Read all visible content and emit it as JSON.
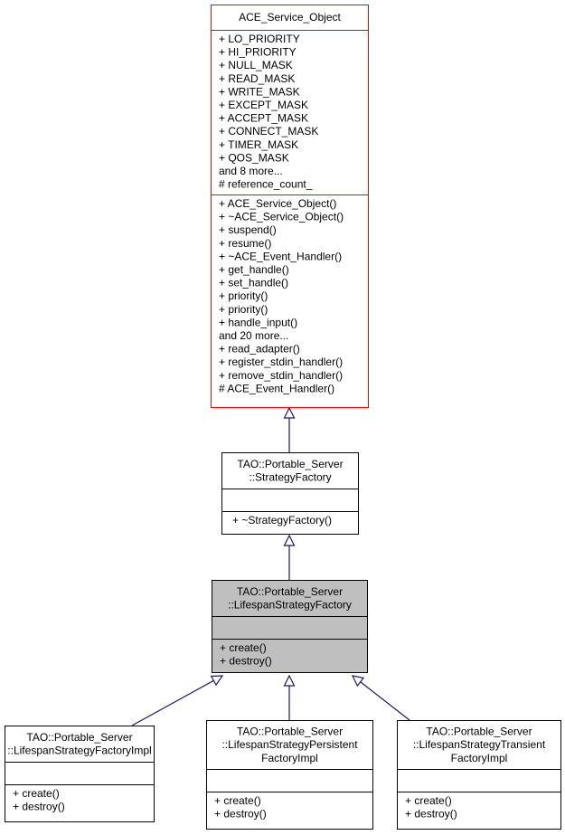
{
  "diagram": {
    "type": "uml-class-inheritance",
    "colors": {
      "highlight_border": "#ff0000",
      "border": "#000000",
      "focus_fill": "#bfbfbf",
      "fill": "#ffffff",
      "edge": "#191970"
    },
    "classes": [
      {
        "id": "ace_service_object",
        "name_lines": [
          "ACE_Service_Object"
        ],
        "attributes": [
          "+ LO_PRIORITY",
          "+ HI_PRIORITY",
          "+ NULL_MASK",
          "+ READ_MASK",
          "+ WRITE_MASK",
          "+ EXCEPT_MASK",
          "+ ACCEPT_MASK",
          "+ CONNECT_MASK",
          "+ TIMER_MASK",
          "+ QOS_MASK",
          "and 8 more...",
          "# reference_count_"
        ],
        "methods": [
          "+ ACE_Service_Object()",
          "+ ~ACE_Service_Object()",
          "+ suspend()",
          "+ resume()",
          "+ ~ACE_Event_Handler()",
          "+ get_handle()",
          "+ set_handle()",
          "+ priority()",
          "+ priority()",
          "+ handle_input()",
          "and 20 more...",
          "+ read_adapter()",
          "+ register_stdin_handler()",
          "+ remove_stdin_handler()",
          "# ACE_Event_Handler()"
        ],
        "style": "highlighted"
      },
      {
        "id": "strategy_factory",
        "name_lines": [
          "TAO::Portable_Server",
          "::StrategyFactory"
        ],
        "attributes": [],
        "methods": [
          "+ ~StrategyFactory()"
        ],
        "style": "normal"
      },
      {
        "id": "lifespan_strategy_factory",
        "name_lines": [
          "TAO::Portable_Server",
          "::LifespanStrategyFactory"
        ],
        "attributes": [],
        "methods": [
          "+ create()",
          "+ destroy()"
        ],
        "style": "focus"
      },
      {
        "id": "lifespan_strategy_factory_impl",
        "name_lines": [
          "TAO::Portable_Server",
          "::LifespanStrategyFactoryImpl"
        ],
        "attributes": [],
        "methods": [
          "+ create()",
          "+ destroy()"
        ],
        "style": "normal"
      },
      {
        "id": "lifespan_strategy_persistent_factory_impl",
        "name_lines": [
          "TAO::Portable_Server",
          "::LifespanStrategyPersistent",
          "FactoryImpl"
        ],
        "attributes": [],
        "methods": [
          "+ create()",
          "+ destroy()"
        ],
        "style": "normal"
      },
      {
        "id": "lifespan_strategy_transient_factory_impl",
        "name_lines": [
          "TAO::Portable_Server",
          "::LifespanStrategyTransient",
          "FactoryImpl"
        ],
        "attributes": [],
        "methods": [
          "+ create()",
          "+ destroy()"
        ],
        "style": "normal"
      }
    ],
    "edges": [
      {
        "from": "strategy_factory",
        "to": "ace_service_object",
        "kind": "inheritance"
      },
      {
        "from": "lifespan_strategy_factory",
        "to": "strategy_factory",
        "kind": "inheritance"
      },
      {
        "from": "lifespan_strategy_factory_impl",
        "to": "lifespan_strategy_factory",
        "kind": "inheritance"
      },
      {
        "from": "lifespan_strategy_persistent_factory_impl",
        "to": "lifespan_strategy_factory",
        "kind": "inheritance"
      },
      {
        "from": "lifespan_strategy_transient_factory_impl",
        "to": "lifespan_strategy_factory",
        "kind": "inheritance"
      }
    ]
  }
}
